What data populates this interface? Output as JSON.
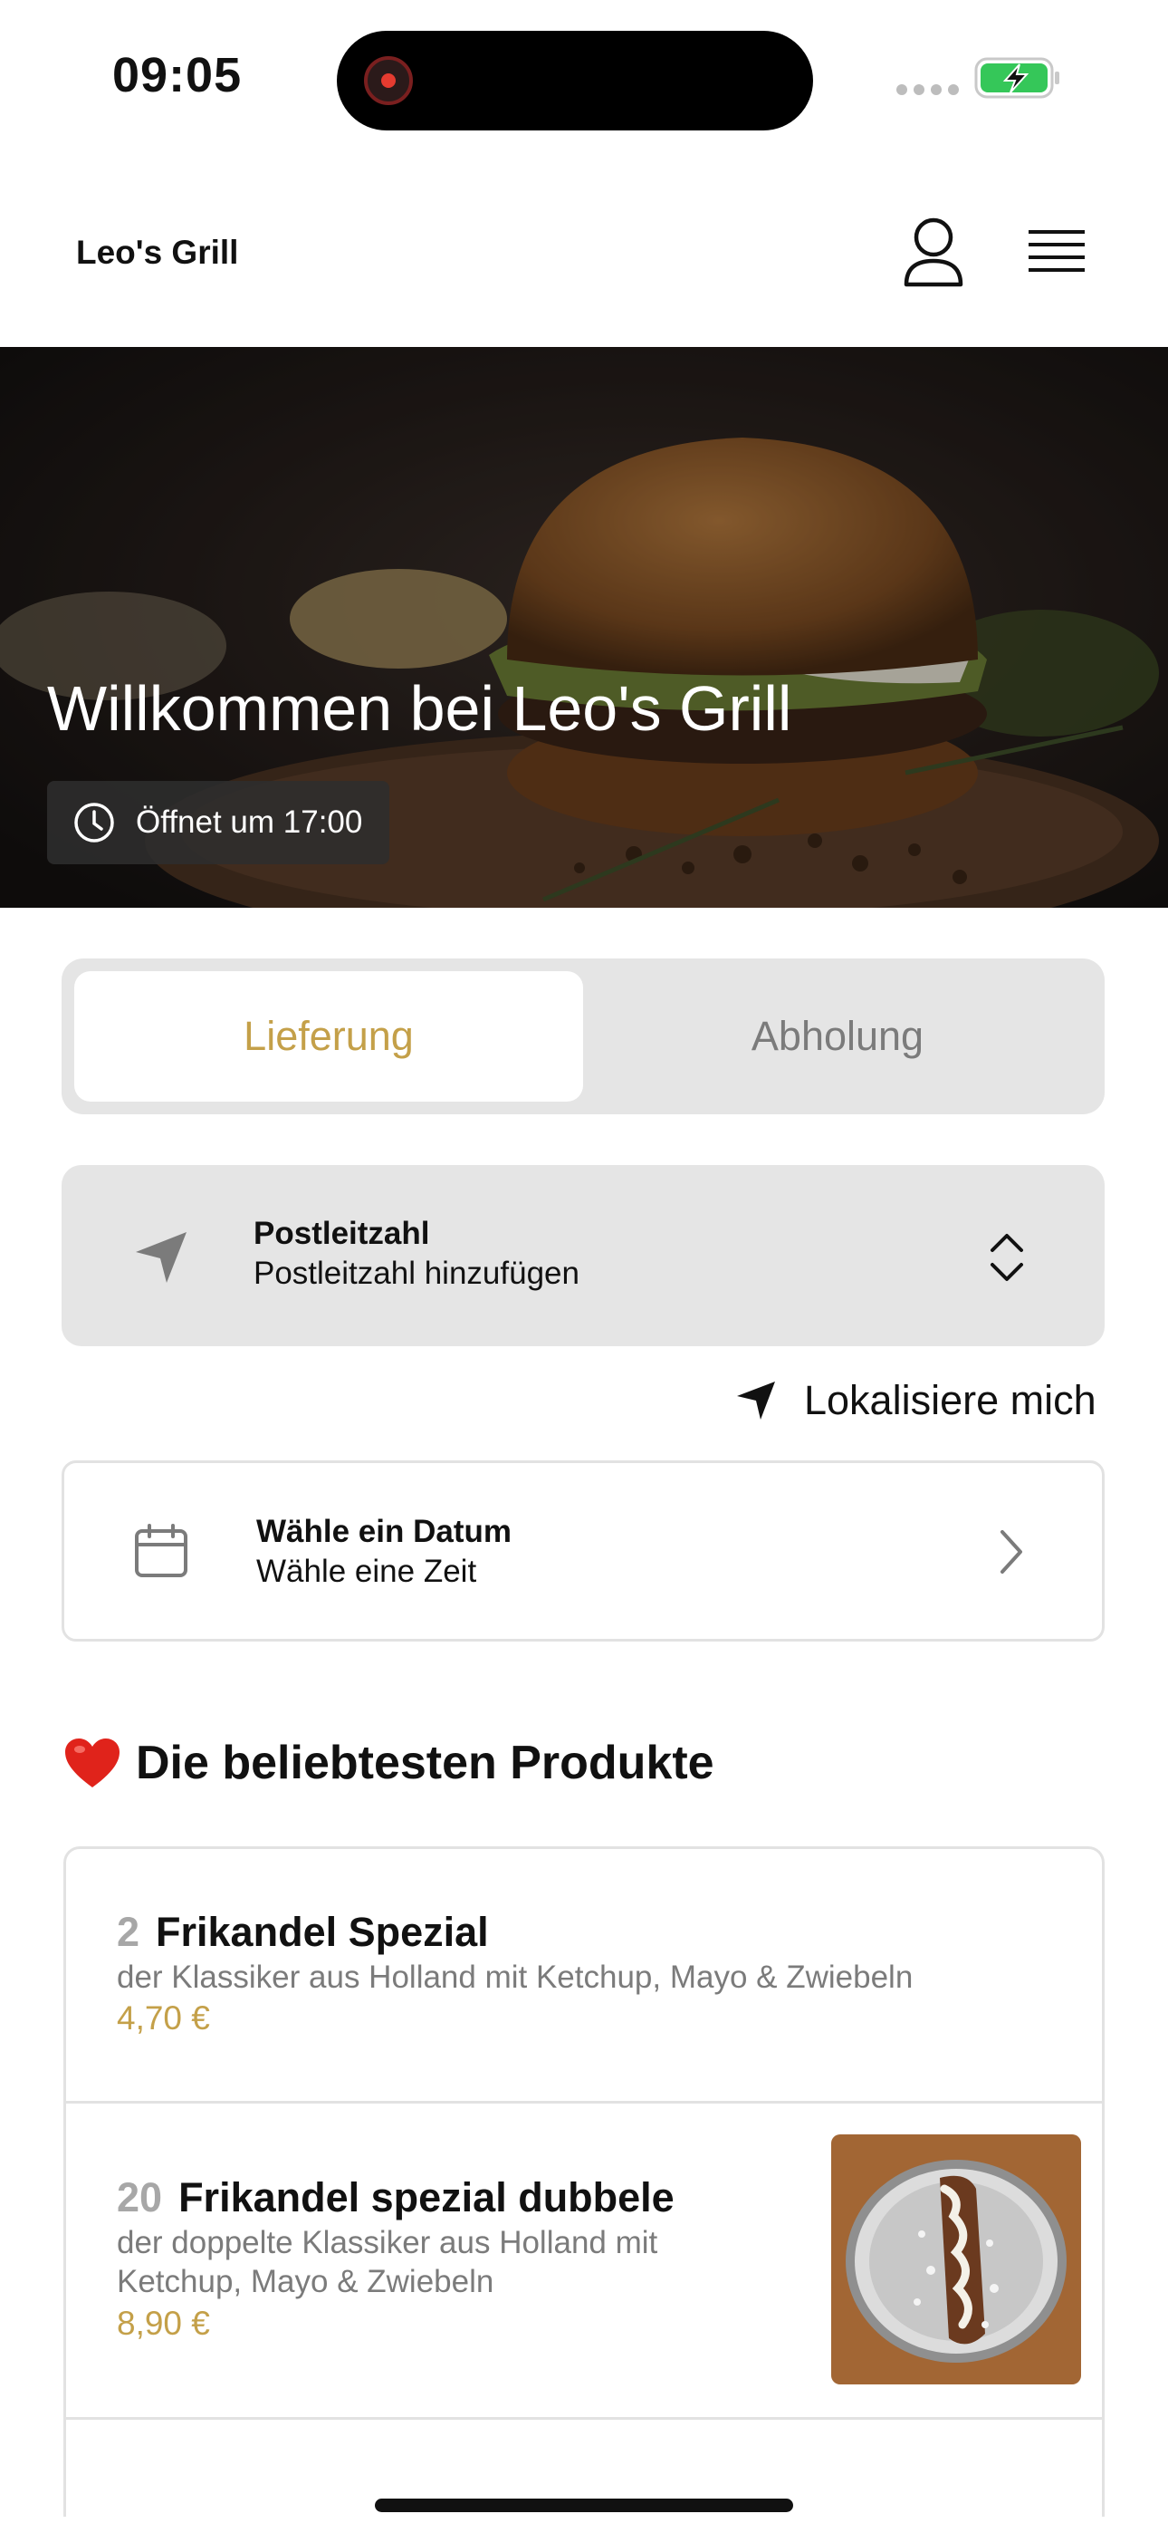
{
  "status_bar": {
    "time": "09:05",
    "battery_state": "charging"
  },
  "header": {
    "title": "Leo's Grill",
    "account_icon": "person-icon",
    "menu_icon": "hamburger-menu-icon"
  },
  "hero": {
    "title": "Willkommen bei Leo's Grill",
    "open_text": "Öffnet um 17:00",
    "clock_icon": "clock-icon"
  },
  "mode_toggle": {
    "delivery_label": "Lieferung",
    "pickup_label": "Abholung",
    "selected": "Lieferung",
    "accent_color": "#c4a049"
  },
  "postcode": {
    "label": "Postleitzahl",
    "placeholder": "Postleitzahl hinzufügen",
    "icon": "location-arrow-icon"
  },
  "locate": {
    "label": "Lokalisiere mich",
    "icon": "navigation-arrow-icon"
  },
  "schedule": {
    "date_label": "Wähle ein Datum",
    "time_label": "Wähle eine Zeit",
    "icon": "calendar-icon"
  },
  "popular": {
    "title": "Die beliebtesten Produkte",
    "icon": "heart-icon",
    "products": [
      {
        "number": "2",
        "name": "Frikandel Spezial",
        "description": "der Klassiker aus Holland mit Ketchup, Mayo & Zwiebeln",
        "price": "4,70 €"
      },
      {
        "number": "20",
        "name": "Frikandel spezial dubbele",
        "description": "der doppelte Klassiker aus Holland mit Ketchup, Mayo & Zwiebeln",
        "price": "8,90 €"
      }
    ]
  }
}
